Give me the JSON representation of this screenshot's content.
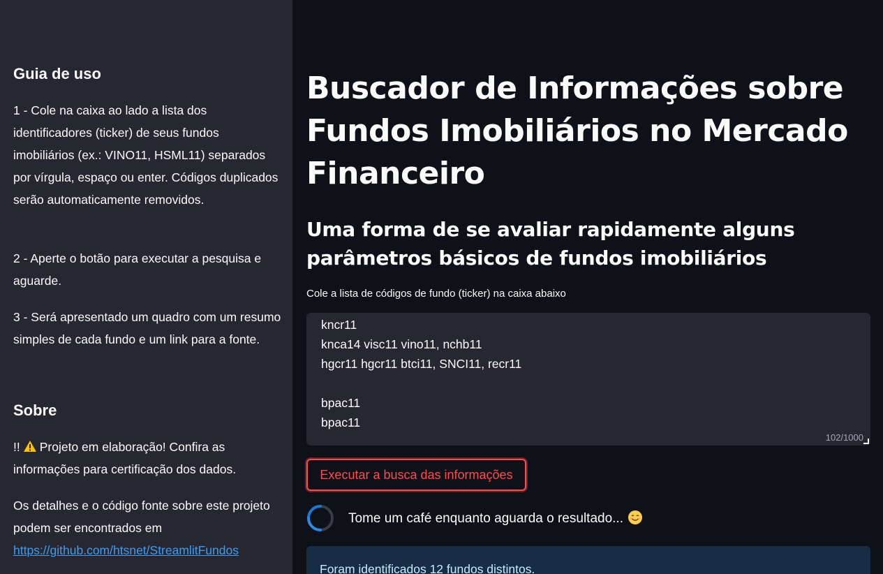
{
  "sidebar": {
    "guide_title": "Guia de uso",
    "guide_step1": "1 - Cole na caixa ao lado a lista dos identificadores (ticker) de seus fundos imobiliários (ex.: VINO11, HSML11) separados por vírgula, espaço ou enter. Códigos duplicados serão automaticamente removidos.",
    "guide_step2": "2 - Aperte o botão para executar a pesquisa e aguarde.",
    "guide_step3": "3 - Será apresentado um quadro com um resumo simples de cada fundo e um link para a fonte.",
    "about_title": "Sobre",
    "about_notice_prefix": "!!",
    "about_notice_text": "Projeto em elaboração! Confira as informações para certificação dos dados.",
    "about_details": "Os detalhes e o código fonte sobre este projeto podem ser encontrados em",
    "about_link": "https://github.com/htsnet/StreamlitFundos"
  },
  "main": {
    "title": "Buscador de Informações sobre Fundos Imobiliários no Mercado Financeiro",
    "subtitle": "Uma forma de se avaliar rapidamente alguns parâmetros básicos de fundos imobiliários",
    "input_label": "Cole a lista de códigos de fundo (ticker) na caixa abaixo",
    "textarea_lines": [
      "kncr11",
      "knca14 visc11 vino11, nchb11",
      "hgcr11 hgcr11 btci11, SNCI11, recr11",
      "",
      "bpac11",
      "bpac11"
    ],
    "char_count": "102/1000",
    "run_button": "Executar a busca das informações",
    "spinner_text": "Tome um café enquanto aguarda o resultado...",
    "info_text": "Foram identificados 12 fundos distintos."
  },
  "colors": {
    "accent": "#ff4b4b",
    "link": "#3d9df3",
    "sidebar_bg": "#262730",
    "main_bg": "#0e1117",
    "info_bg": "#172d43"
  },
  "icons": [
    "warning-icon",
    "smiling-face-icon",
    "spinner-icon",
    "resize-handle-icon"
  ]
}
